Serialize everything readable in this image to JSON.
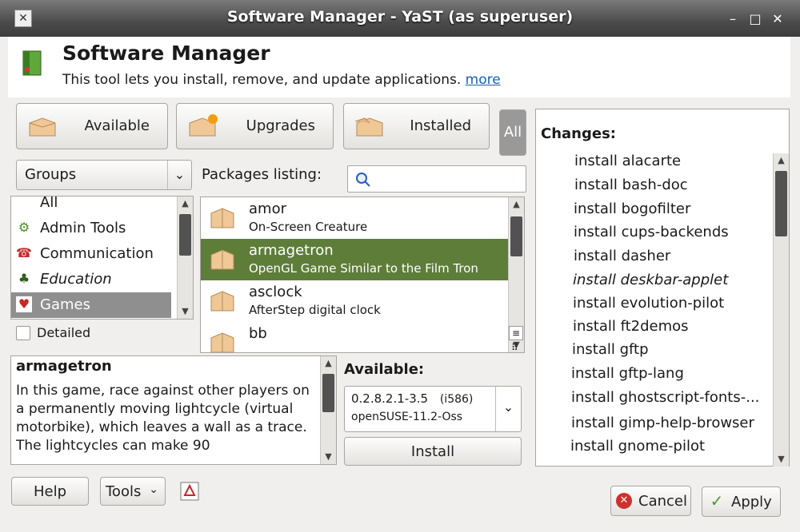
{
  "window": {
    "title": "Software Manager - YaST (as superuser)"
  },
  "header": {
    "title": "Software Manager",
    "subtitle": "This tool lets you install, remove, and update applications.",
    "more_link": "more"
  },
  "filters": {
    "available": "Available",
    "upgrades": "Upgrades",
    "installed": "Installed",
    "all": "All"
  },
  "groups_combo": {
    "value": "Groups"
  },
  "groups": [
    {
      "label": "All",
      "icon": "all-icon"
    },
    {
      "label": "Admin Tools",
      "icon": "admin-tools-icon"
    },
    {
      "label": "Communication",
      "icon": "telephone-icon"
    },
    {
      "label": "Education",
      "icon": "education-icon"
    },
    {
      "label": "Games",
      "icon": "playing-cards-icon",
      "selected": true
    }
  ],
  "detailed_checkbox": {
    "label": "Detailed",
    "checked": false
  },
  "packages_listing": {
    "label": "Packages listing:"
  },
  "packages": [
    {
      "name": "amor",
      "description": "On-Screen Creature"
    },
    {
      "name": "armagetron",
      "description": "OpenGL Game Similar to the Film Tron",
      "selected": true
    },
    {
      "name": "asclock",
      "description": "AfterStep digital clock"
    },
    {
      "name": "bb",
      "description": ""
    }
  ],
  "details": {
    "title": "armagetron",
    "text": "In this game, race against other players on a permanently moving lightcycle (virtual motorbike), which leaves a wall as a trace. The lightcycles can make 90"
  },
  "available_section": {
    "label": "Available:",
    "version": "0.2.8.2.1-3.5",
    "arch": "(i586)",
    "repository": "openSUSE-11.2-Oss",
    "install_button": "Install"
  },
  "changes": {
    "title": "Changes:",
    "items": [
      "install alacarte",
      "install bash-doc",
      "install bogofilter",
      "install cups-backends",
      "install dasher",
      "install deskbar-applet",
      "install evolution-pilot",
      "install ft2demos",
      "install gftp",
      "install gftp-lang",
      "install ghostscript-fonts-...",
      "install gimp-help-browser",
      "install gnome-pilot"
    ]
  },
  "footer": {
    "help": "Help",
    "tools": "Tools",
    "cancel": "Cancel",
    "apply": "Apply"
  },
  "colors": {
    "selection_green": "#5e7d39",
    "selection_gray": "#8f8f8f",
    "link_blue": "#1a5fb4",
    "cancel_red": "#d0312d",
    "apply_green": "#4a9a2a"
  }
}
